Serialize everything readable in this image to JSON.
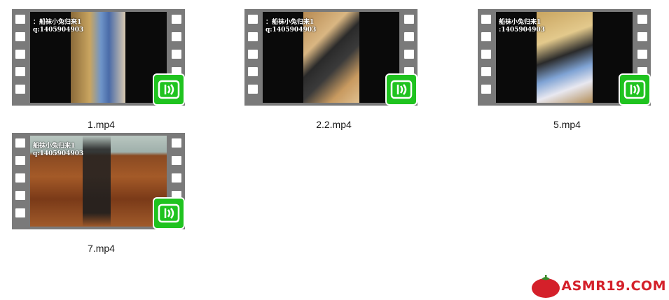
{
  "files": [
    {
      "name": "1.mp4",
      "watermark_line1": "：船袜小兔归来1",
      "watermark_line2": "q:1405904903"
    },
    {
      "name": "2.2.mp4",
      "watermark_line1": "：船袜小兔归来1",
      "watermark_line2": "q:1405904903"
    },
    {
      "name": "5.mp4",
      "watermark_line1": "船袜小兔归来1",
      "watermark_line2": ":1405904903"
    },
    {
      "name": "7.mp4",
      "watermark_line1": "船袜小兔归来1",
      "watermark_line2": "q:1405904903"
    }
  ],
  "site_logo": {
    "text": "ASMR19.COM",
    "brand_color": "#d4202a"
  },
  "colors": {
    "badge_green": "#1fc31f",
    "film_gray": "#7a7a7a"
  },
  "icons": {
    "video_badge": "broadcast-play-icon",
    "logo_mark": "tomato-icon"
  }
}
